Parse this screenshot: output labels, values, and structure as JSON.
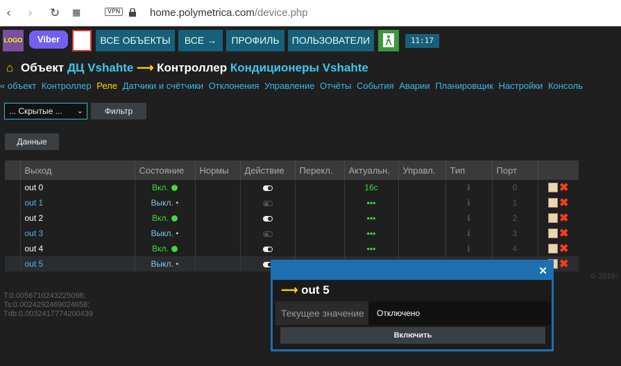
{
  "browser": {
    "url_host": "home.polymetrica.com",
    "url_path": "/device.php",
    "vpn_label": "VPN"
  },
  "topbar": {
    "logo": "LOGO",
    "viber": "Viber",
    "buttons": [
      "ВСЕ ОБЪЕКТЫ",
      "ВСЕ →",
      "ПРОФИЛЬ",
      "ПОЛЬЗОВАТЕЛИ"
    ],
    "clock": "11:17"
  },
  "title": {
    "object_label": "Объект",
    "object_name": "ДЦ Vshahte",
    "controller_label": "Контроллер",
    "controller_name": "Кондиционеры Vshahte"
  },
  "subnav": [
    "« объект",
    "Контроллер",
    "Реле",
    "Датчики и счётчики",
    "Отклонения",
    "Управление",
    "Отчёты",
    "События",
    "Аварии",
    "Планировщик",
    "Настройки",
    "Консоль"
  ],
  "filter": {
    "select_value": "... Скрытые ...",
    "filter_button": "Фильтр",
    "data_button": "Данные"
  },
  "table": {
    "headers": [
      "Выход",
      "Состояние",
      "Нормы",
      "Действие",
      "Перекл.",
      "Актуальн.",
      "Управл.",
      "Тип",
      "Порт",
      ""
    ],
    "rows": [
      {
        "name": "out 0",
        "state": "Вкл.",
        "on": true,
        "actual": "16с",
        "type": "ℹ",
        "port": "0"
      },
      {
        "name": "out 1",
        "state": "Выкл. •",
        "on": false,
        "actual": "▪▪▪",
        "type": "ℹ",
        "port": "1"
      },
      {
        "name": "out 2",
        "state": "Вкл.",
        "on": true,
        "actual": "▪▪▪",
        "type": "ℹ",
        "port": "2"
      },
      {
        "name": "out 3",
        "state": "Выкл. •",
        "on": false,
        "actual": "▪▪▪",
        "type": "ℹ",
        "port": "3"
      },
      {
        "name": "out 4",
        "state": "Вкл.",
        "on": true,
        "actual": "▪▪▪",
        "type": "ℹ",
        "port": "4"
      },
      {
        "name": "out 5",
        "state": "Выкл. •",
        "on": false,
        "actual": "",
        "type": "",
        "port": ""
      }
    ]
  },
  "copyright": "© 2016-",
  "timing": [
    "T:0.0056710243225098;",
    "Ts:0.0024292469024658;",
    "Tdb:0.0032417774200439"
  ],
  "popup": {
    "title": "out 5",
    "label": "Текущее значение",
    "value": "Отключено",
    "button": "Включить"
  },
  "colors": {
    "accent": "#17607a",
    "link": "#3cb8e6",
    "highlight": "#ffd800",
    "on": "#3ddc3d",
    "popup_border": "#1e6fb0"
  }
}
